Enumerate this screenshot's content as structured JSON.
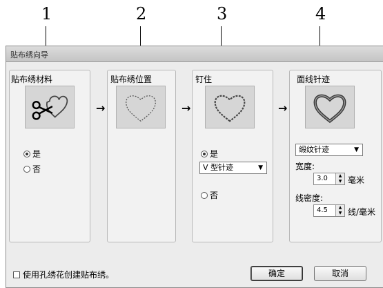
{
  "callouts": [
    "1",
    "2",
    "3",
    "4"
  ],
  "window": {
    "title": "贴布绣向导"
  },
  "panels": [
    {
      "title": "贴布绣材料",
      "options": [
        {
          "label": "是",
          "selected": true
        },
        {
          "label": "否",
          "selected": false
        }
      ]
    },
    {
      "title": "贴布绣位置"
    },
    {
      "title": "钉住",
      "options": [
        {
          "label": "是",
          "selected": true
        },
        {
          "label": "否",
          "selected": false
        }
      ],
      "stitch_select": "V 型针迹"
    },
    {
      "title": "面线针迹",
      "stitch_select": "缎纹针迹",
      "width_label": "宽度:",
      "width_value": "3.0",
      "width_unit": "毫米",
      "density_label": "线密度:",
      "density_value": "4.5",
      "density_unit": "线/毫米"
    }
  ],
  "arrows": [
    "→",
    "→",
    "→"
  ],
  "footer": {
    "checkbox_label": "使用孔绣花创建贴布绣。",
    "checkbox_checked": false,
    "ok_label": "确定",
    "cancel_label": "取消"
  },
  "icons": [
    "scissors-heart-icon",
    "dotted-heart-icon",
    "wavy-heart-icon",
    "satin-heart-icon"
  ]
}
